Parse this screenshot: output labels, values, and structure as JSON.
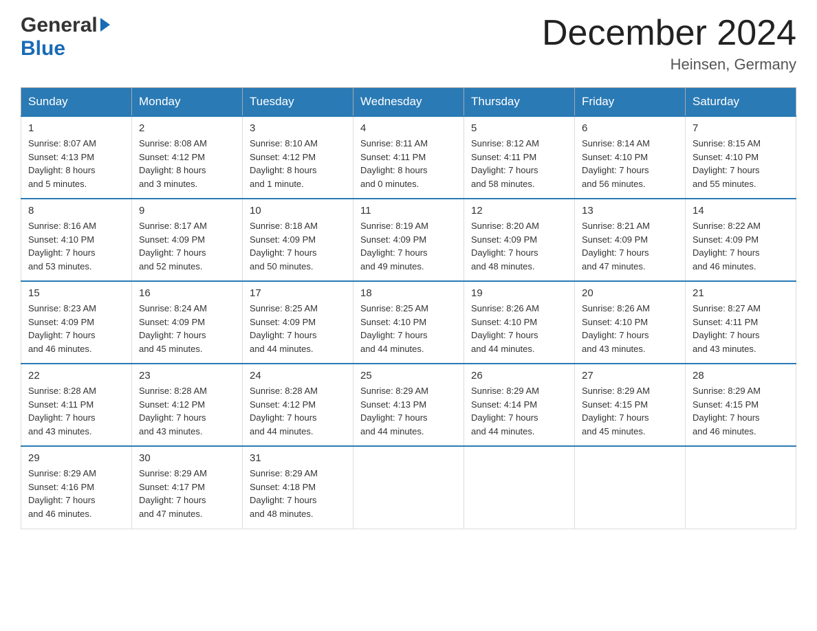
{
  "header": {
    "logo_general": "General",
    "logo_blue": "Blue",
    "month_title": "December 2024",
    "location": "Heinsen, Germany"
  },
  "days_of_week": [
    "Sunday",
    "Monday",
    "Tuesday",
    "Wednesday",
    "Thursday",
    "Friday",
    "Saturday"
  ],
  "weeks": [
    [
      {
        "day": "1",
        "sunrise": "8:07 AM",
        "sunset": "4:13 PM",
        "daylight": "8 hours and 5 minutes."
      },
      {
        "day": "2",
        "sunrise": "8:08 AM",
        "sunset": "4:12 PM",
        "daylight": "8 hours and 3 minutes."
      },
      {
        "day": "3",
        "sunrise": "8:10 AM",
        "sunset": "4:12 PM",
        "daylight": "8 hours and 1 minute."
      },
      {
        "day": "4",
        "sunrise": "8:11 AM",
        "sunset": "4:11 PM",
        "daylight": "8 hours and 0 minutes."
      },
      {
        "day": "5",
        "sunrise": "8:12 AM",
        "sunset": "4:11 PM",
        "daylight": "7 hours and 58 minutes."
      },
      {
        "day": "6",
        "sunrise": "8:14 AM",
        "sunset": "4:10 PM",
        "daylight": "7 hours and 56 minutes."
      },
      {
        "day": "7",
        "sunrise": "8:15 AM",
        "sunset": "4:10 PM",
        "daylight": "7 hours and 55 minutes."
      }
    ],
    [
      {
        "day": "8",
        "sunrise": "8:16 AM",
        "sunset": "4:10 PM",
        "daylight": "7 hours and 53 minutes."
      },
      {
        "day": "9",
        "sunrise": "8:17 AM",
        "sunset": "4:09 PM",
        "daylight": "7 hours and 52 minutes."
      },
      {
        "day": "10",
        "sunrise": "8:18 AM",
        "sunset": "4:09 PM",
        "daylight": "7 hours and 50 minutes."
      },
      {
        "day": "11",
        "sunrise": "8:19 AM",
        "sunset": "4:09 PM",
        "daylight": "7 hours and 49 minutes."
      },
      {
        "day": "12",
        "sunrise": "8:20 AM",
        "sunset": "4:09 PM",
        "daylight": "7 hours and 48 minutes."
      },
      {
        "day": "13",
        "sunrise": "8:21 AM",
        "sunset": "4:09 PM",
        "daylight": "7 hours and 47 minutes."
      },
      {
        "day": "14",
        "sunrise": "8:22 AM",
        "sunset": "4:09 PM",
        "daylight": "7 hours and 46 minutes."
      }
    ],
    [
      {
        "day": "15",
        "sunrise": "8:23 AM",
        "sunset": "4:09 PM",
        "daylight": "7 hours and 46 minutes."
      },
      {
        "day": "16",
        "sunrise": "8:24 AM",
        "sunset": "4:09 PM",
        "daylight": "7 hours and 45 minutes."
      },
      {
        "day": "17",
        "sunrise": "8:25 AM",
        "sunset": "4:09 PM",
        "daylight": "7 hours and 44 minutes."
      },
      {
        "day": "18",
        "sunrise": "8:25 AM",
        "sunset": "4:10 PM",
        "daylight": "7 hours and 44 minutes."
      },
      {
        "day": "19",
        "sunrise": "8:26 AM",
        "sunset": "4:10 PM",
        "daylight": "7 hours and 44 minutes."
      },
      {
        "day": "20",
        "sunrise": "8:26 AM",
        "sunset": "4:10 PM",
        "daylight": "7 hours and 43 minutes."
      },
      {
        "day": "21",
        "sunrise": "8:27 AM",
        "sunset": "4:11 PM",
        "daylight": "7 hours and 43 minutes."
      }
    ],
    [
      {
        "day": "22",
        "sunrise": "8:28 AM",
        "sunset": "4:11 PM",
        "daylight": "7 hours and 43 minutes."
      },
      {
        "day": "23",
        "sunrise": "8:28 AM",
        "sunset": "4:12 PM",
        "daylight": "7 hours and 43 minutes."
      },
      {
        "day": "24",
        "sunrise": "8:28 AM",
        "sunset": "4:12 PM",
        "daylight": "7 hours and 44 minutes."
      },
      {
        "day": "25",
        "sunrise": "8:29 AM",
        "sunset": "4:13 PM",
        "daylight": "7 hours and 44 minutes."
      },
      {
        "day": "26",
        "sunrise": "8:29 AM",
        "sunset": "4:14 PM",
        "daylight": "7 hours and 44 minutes."
      },
      {
        "day": "27",
        "sunrise": "8:29 AM",
        "sunset": "4:15 PM",
        "daylight": "7 hours and 45 minutes."
      },
      {
        "day": "28",
        "sunrise": "8:29 AM",
        "sunset": "4:15 PM",
        "daylight": "7 hours and 46 minutes."
      }
    ],
    [
      {
        "day": "29",
        "sunrise": "8:29 AM",
        "sunset": "4:16 PM",
        "daylight": "7 hours and 46 minutes."
      },
      {
        "day": "30",
        "sunrise": "8:29 AM",
        "sunset": "4:17 PM",
        "daylight": "7 hours and 47 minutes."
      },
      {
        "day": "31",
        "sunrise": "8:29 AM",
        "sunset": "4:18 PM",
        "daylight": "7 hours and 48 minutes."
      },
      null,
      null,
      null,
      null
    ]
  ],
  "labels": {
    "sunrise": "Sunrise:",
    "sunset": "Sunset:",
    "daylight": "Daylight:"
  }
}
